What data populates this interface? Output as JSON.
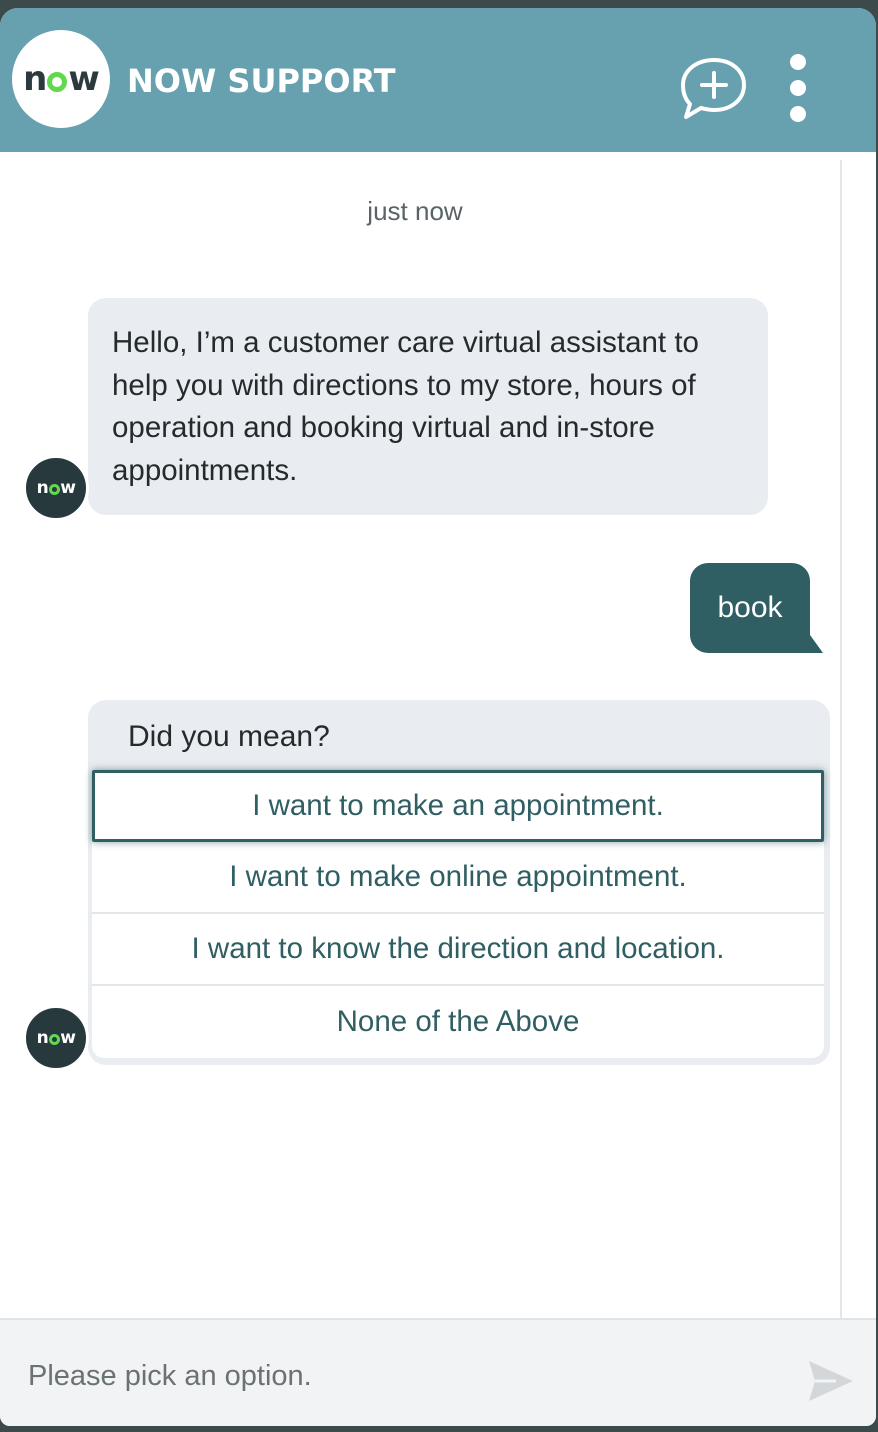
{
  "header": {
    "logo_text_left": "n",
    "logo_text_right": "w",
    "title": "NOW SUPPORT",
    "brand_color": "#67a1b0",
    "accent_color": "#62d84e"
  },
  "chat": {
    "timestamp": "just now",
    "bot_message": "Hello, I’m a customer care virtual assistant to help you with directions to my store, hours of operation and booking virtual and in-store appointments.",
    "user_message": "book",
    "options_title": "Did you mean?",
    "options": [
      "I want to make an appointment.",
      "I want to make online appointment.",
      "I want to know the direction and location.",
      "None of the Above"
    ],
    "avatar_text_left": "n",
    "avatar_text_right": "w",
    "user_bubble_color": "#2f5e63"
  },
  "input": {
    "placeholder": "Please pick an option."
  },
  "icons": {
    "new_chat": "chat-plus-icon",
    "menu": "kebab-menu-icon",
    "send": "send-icon"
  }
}
